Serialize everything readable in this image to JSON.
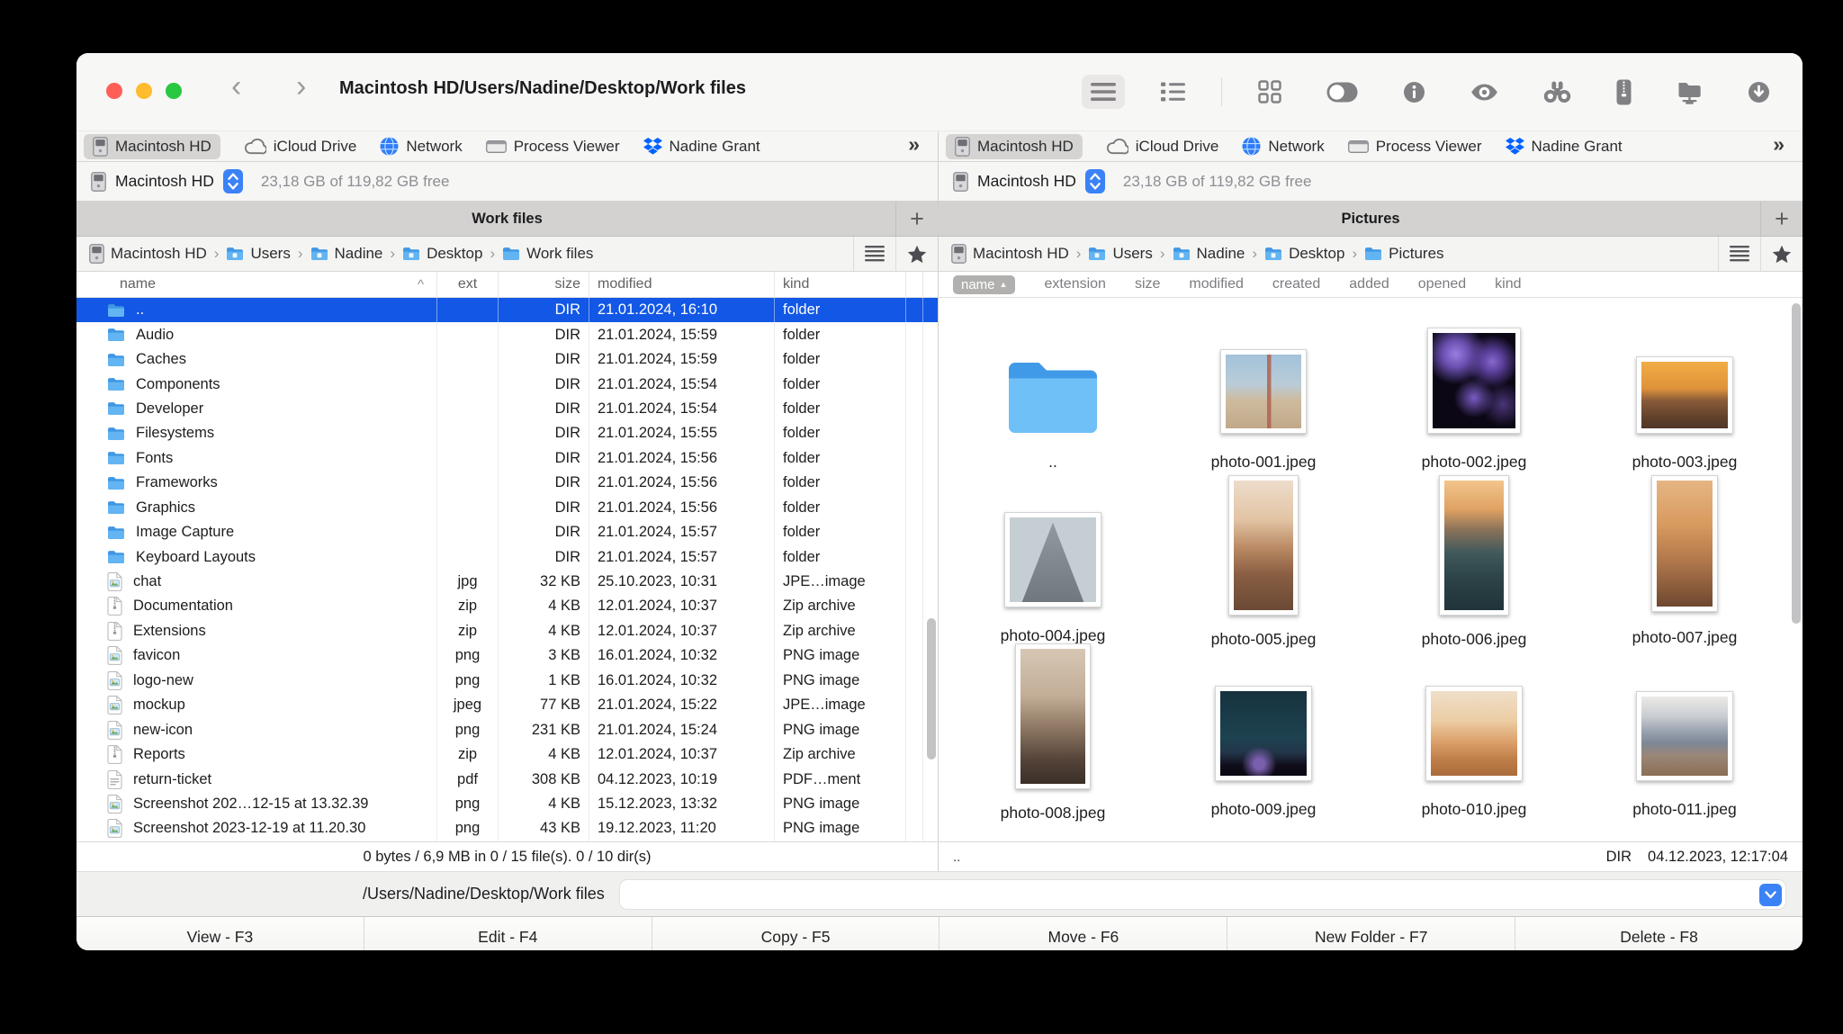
{
  "window": {
    "title": "Macintosh HD/Users/Nadine/Desktop/Work files"
  },
  "toolbar": {
    "items": [
      {
        "icon": "list-view",
        "selected": true
      },
      {
        "icon": "detail-list-view"
      },
      {
        "divider": true
      },
      {
        "icon": "grid-view"
      },
      {
        "icon": "preview-toggle"
      },
      {
        "icon": "info"
      },
      {
        "icon": "quick-look-eye"
      },
      {
        "icon": "search-binoculars"
      },
      {
        "icon": "archive-zip"
      },
      {
        "icon": "network-folder"
      },
      {
        "icon": "download"
      }
    ]
  },
  "favorites": {
    "items": [
      {
        "label": "Macintosh HD",
        "icon": "harddrive",
        "selected": true
      },
      {
        "label": "iCloud Drive",
        "icon": "cloud"
      },
      {
        "label": "Network",
        "icon": "globe"
      },
      {
        "label": "Process Viewer",
        "icon": "app-window"
      },
      {
        "label": "Nadine Grant",
        "icon": "dropbox"
      }
    ],
    "overflow": "»"
  },
  "drive": {
    "name": "Macintosh HD",
    "free": "23,18 GB of 119,82 GB free"
  },
  "left_pane": {
    "tab": "Work files",
    "add_tab": "+",
    "breadcrumb": [
      "Macintosh HD",
      "Users",
      "Nadine",
      "Desktop",
      "Work files"
    ],
    "columns": [
      "name",
      "ext",
      "size",
      "modified",
      "kind"
    ],
    "sort_indicator": "^",
    "rows": [
      {
        "name": "..",
        "ext": "",
        "size": "DIR",
        "modified": "21.01.2024, 16:10",
        "kind": "folder",
        "icon": "folder",
        "selected": true
      },
      {
        "name": "Audio",
        "ext": "",
        "size": "DIR",
        "modified": "21.01.2024, 15:59",
        "kind": "folder",
        "icon": "folder"
      },
      {
        "name": "Caches",
        "ext": "",
        "size": "DIR",
        "modified": "21.01.2024, 15:59",
        "kind": "folder",
        "icon": "folder"
      },
      {
        "name": "Components",
        "ext": "",
        "size": "DIR",
        "modified": "21.01.2024, 15:54",
        "kind": "folder",
        "icon": "folder"
      },
      {
        "name": "Developer",
        "ext": "",
        "size": "DIR",
        "modified": "21.01.2024, 15:54",
        "kind": "folder",
        "icon": "folder"
      },
      {
        "name": "Filesystems",
        "ext": "",
        "size": "DIR",
        "modified": "21.01.2024, 15:55",
        "kind": "folder",
        "icon": "folder"
      },
      {
        "name": "Fonts",
        "ext": "",
        "size": "DIR",
        "modified": "21.01.2024, 15:56",
        "kind": "folder",
        "icon": "folder"
      },
      {
        "name": "Frameworks",
        "ext": "",
        "size": "DIR",
        "modified": "21.01.2024, 15:56",
        "kind": "folder",
        "icon": "folder"
      },
      {
        "name": "Graphics",
        "ext": "",
        "size": "DIR",
        "modified": "21.01.2024, 15:56",
        "kind": "folder",
        "icon": "folder"
      },
      {
        "name": "Image Capture",
        "ext": "",
        "size": "DIR",
        "modified": "21.01.2024, 15:57",
        "kind": "folder",
        "icon": "folder"
      },
      {
        "name": "Keyboard Layouts",
        "ext": "",
        "size": "DIR",
        "modified": "21.01.2024, 15:57",
        "kind": "folder",
        "icon": "folder"
      },
      {
        "name": "chat",
        "ext": "jpg",
        "size": "32 KB",
        "modified": "25.10.2023, 10:31",
        "kind": "JPE…image",
        "icon": "image-file"
      },
      {
        "name": "Documentation",
        "ext": "zip",
        "size": "4 KB",
        "modified": "12.01.2024, 10:37",
        "kind": "Zip archive",
        "icon": "zip-file"
      },
      {
        "name": "Extensions",
        "ext": "zip",
        "size": "4 KB",
        "modified": "12.01.2024, 10:37",
        "kind": "Zip archive",
        "icon": "zip-file"
      },
      {
        "name": "favicon",
        "ext": "png",
        "size": "3 KB",
        "modified": "16.01.2024, 10:32",
        "kind": "PNG image",
        "icon": "image-file"
      },
      {
        "name": "logo-new",
        "ext": "png",
        "size": "1 KB",
        "modified": "16.01.2024, 10:32",
        "kind": "PNG image",
        "icon": "image-file"
      },
      {
        "name": "mockup",
        "ext": "jpeg",
        "size": "77 KB",
        "modified": "21.01.2024, 15:22",
        "kind": "JPE…image",
        "icon": "image-file"
      },
      {
        "name": "new-icon",
        "ext": "png",
        "size": "231 KB",
        "modified": "21.01.2024, 15:24",
        "kind": "PNG image",
        "icon": "image-file"
      },
      {
        "name": "Reports",
        "ext": "zip",
        "size": "4 KB",
        "modified": "12.01.2024, 10:37",
        "kind": "Zip archive",
        "icon": "zip-file"
      },
      {
        "name": "return-ticket",
        "ext": "pdf",
        "size": "308 KB",
        "modified": "04.12.2023, 10:19",
        "kind": "PDF…ment",
        "icon": "pdf-file"
      },
      {
        "name": "Screenshot 202…12-15 at 13.32.39",
        "ext": "png",
        "size": "4 KB",
        "modified": "15.12.2023, 13:32",
        "kind": "PNG image",
        "icon": "image-file"
      },
      {
        "name": "Screenshot 2023-12-19 at 11.20.30",
        "ext": "png",
        "size": "43 KB",
        "modified": "19.12.2023, 11:20",
        "kind": "PNG image",
        "icon": "image-file"
      }
    ],
    "status": "0 bytes / 6,9 MB in 0 / 15 file(s). 0 / 10 dir(s)"
  },
  "right_pane": {
    "tab": "Pictures",
    "add_tab": "+",
    "breadcrumb": [
      "Macintosh HD",
      "Users",
      "Nadine",
      "Desktop",
      "Pictures"
    ],
    "columns": [
      "name",
      "extension",
      "size",
      "modified",
      "created",
      "added",
      "opened",
      "kind"
    ],
    "sort_indicator": "▲",
    "items": [
      {
        "label": "..",
        "type": "folder"
      },
      {
        "label": "photo-001.jpeg",
        "type": "image",
        "thumb": "t1"
      },
      {
        "label": "photo-002.jpeg",
        "type": "image",
        "thumb": "t2"
      },
      {
        "label": "photo-003.jpeg",
        "type": "image",
        "thumb": "t3"
      },
      {
        "label": "photo-004.jpeg",
        "type": "image",
        "thumb": "t4"
      },
      {
        "label": "photo-005.jpeg",
        "type": "image",
        "thumb": "t5"
      },
      {
        "label": "photo-006.jpeg",
        "type": "image",
        "thumb": "t6"
      },
      {
        "label": "photo-007.jpeg",
        "type": "image",
        "thumb": "t7"
      },
      {
        "label": "photo-008.jpeg",
        "type": "image",
        "thumb": "t8"
      },
      {
        "label": "photo-009.jpeg",
        "type": "image",
        "thumb": "t9"
      },
      {
        "label": "photo-010.jpeg",
        "type": "image",
        "thumb": "t10"
      },
      {
        "label": "photo-011.jpeg",
        "type": "image",
        "thumb": "t11"
      }
    ],
    "status_left": "..",
    "status_kind": "DIR",
    "status_date": "04.12.2023, 12:17:04"
  },
  "command_bar": {
    "path": "/Users/Nadine/Desktop/Work files",
    "input_value": ""
  },
  "function_bar": [
    "View - F3",
    "Edit - F4",
    "Copy - F5",
    "Move - F6",
    "New Folder - F7",
    "Delete - F8"
  ],
  "colors": {
    "selection": "#1257e5",
    "accent_blue": "#3b82f7",
    "dropbox_blue": "#0062ff"
  }
}
